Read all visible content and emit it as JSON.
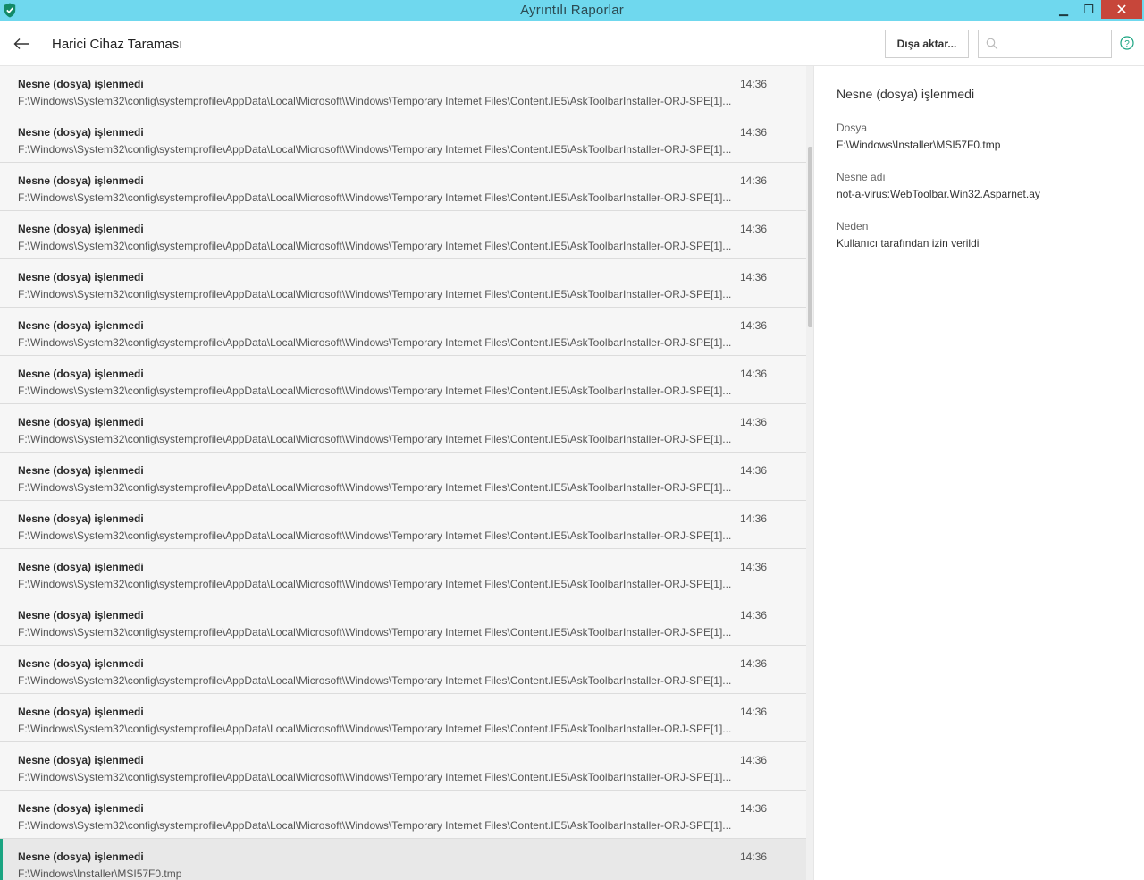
{
  "window": {
    "title": "Ayrıntılı Raporlar",
    "minimize_glyph": "▁",
    "restore_glyph": "❐",
    "close_glyph": "✕"
  },
  "header": {
    "title": "Harici Cihaz Taraması",
    "export_label": "Dışa aktar...",
    "search_placeholder": "",
    "search_value": ""
  },
  "list": {
    "items": [
      {
        "title": "Nesne (dosya) işlenmedi",
        "time": "14:36",
        "path": "F:\\Windows\\System32\\config\\systemprofile\\AppData\\Local\\Microsoft\\Windows\\Temporary Internet Files\\Content.IE5\\AskToolbarInstaller-ORJ-SPE[1]..."
      },
      {
        "title": "Nesne (dosya) işlenmedi",
        "time": "14:36",
        "path": "F:\\Windows\\System32\\config\\systemprofile\\AppData\\Local\\Microsoft\\Windows\\Temporary Internet Files\\Content.IE5\\AskToolbarInstaller-ORJ-SPE[1]..."
      },
      {
        "title": "Nesne (dosya) işlenmedi",
        "time": "14:36",
        "path": "F:\\Windows\\System32\\config\\systemprofile\\AppData\\Local\\Microsoft\\Windows\\Temporary Internet Files\\Content.IE5\\AskToolbarInstaller-ORJ-SPE[1]..."
      },
      {
        "title": "Nesne (dosya) işlenmedi",
        "time": "14:36",
        "path": "F:\\Windows\\System32\\config\\systemprofile\\AppData\\Local\\Microsoft\\Windows\\Temporary Internet Files\\Content.IE5\\AskToolbarInstaller-ORJ-SPE[1]..."
      },
      {
        "title": "Nesne (dosya) işlenmedi",
        "time": "14:36",
        "path": "F:\\Windows\\System32\\config\\systemprofile\\AppData\\Local\\Microsoft\\Windows\\Temporary Internet Files\\Content.IE5\\AskToolbarInstaller-ORJ-SPE[1]..."
      },
      {
        "title": "Nesne (dosya) işlenmedi",
        "time": "14:36",
        "path": "F:\\Windows\\System32\\config\\systemprofile\\AppData\\Local\\Microsoft\\Windows\\Temporary Internet Files\\Content.IE5\\AskToolbarInstaller-ORJ-SPE[1]..."
      },
      {
        "title": "Nesne (dosya) işlenmedi",
        "time": "14:36",
        "path": "F:\\Windows\\System32\\config\\systemprofile\\AppData\\Local\\Microsoft\\Windows\\Temporary Internet Files\\Content.IE5\\AskToolbarInstaller-ORJ-SPE[1]..."
      },
      {
        "title": "Nesne (dosya) işlenmedi",
        "time": "14:36",
        "path": "F:\\Windows\\System32\\config\\systemprofile\\AppData\\Local\\Microsoft\\Windows\\Temporary Internet Files\\Content.IE5\\AskToolbarInstaller-ORJ-SPE[1]..."
      },
      {
        "title": "Nesne (dosya) işlenmedi",
        "time": "14:36",
        "path": "F:\\Windows\\System32\\config\\systemprofile\\AppData\\Local\\Microsoft\\Windows\\Temporary Internet Files\\Content.IE5\\AskToolbarInstaller-ORJ-SPE[1]..."
      },
      {
        "title": "Nesne (dosya) işlenmedi",
        "time": "14:36",
        "path": "F:\\Windows\\System32\\config\\systemprofile\\AppData\\Local\\Microsoft\\Windows\\Temporary Internet Files\\Content.IE5\\AskToolbarInstaller-ORJ-SPE[1]..."
      },
      {
        "title": "Nesne (dosya) işlenmedi",
        "time": "14:36",
        "path": "F:\\Windows\\System32\\config\\systemprofile\\AppData\\Local\\Microsoft\\Windows\\Temporary Internet Files\\Content.IE5\\AskToolbarInstaller-ORJ-SPE[1]..."
      },
      {
        "title": "Nesne (dosya) işlenmedi",
        "time": "14:36",
        "path": "F:\\Windows\\System32\\config\\systemprofile\\AppData\\Local\\Microsoft\\Windows\\Temporary Internet Files\\Content.IE5\\AskToolbarInstaller-ORJ-SPE[1]..."
      },
      {
        "title": "Nesne (dosya) işlenmedi",
        "time": "14:36",
        "path": "F:\\Windows\\System32\\config\\systemprofile\\AppData\\Local\\Microsoft\\Windows\\Temporary Internet Files\\Content.IE5\\AskToolbarInstaller-ORJ-SPE[1]..."
      },
      {
        "title": "Nesne (dosya) işlenmedi",
        "time": "14:36",
        "path": "F:\\Windows\\System32\\config\\systemprofile\\AppData\\Local\\Microsoft\\Windows\\Temporary Internet Files\\Content.IE5\\AskToolbarInstaller-ORJ-SPE[1]..."
      },
      {
        "title": "Nesne (dosya) işlenmedi",
        "time": "14:36",
        "path": "F:\\Windows\\System32\\config\\systemprofile\\AppData\\Local\\Microsoft\\Windows\\Temporary Internet Files\\Content.IE5\\AskToolbarInstaller-ORJ-SPE[1]..."
      },
      {
        "title": "Nesne (dosya) işlenmedi",
        "time": "14:36",
        "path": "F:\\Windows\\System32\\config\\systemprofile\\AppData\\Local\\Microsoft\\Windows\\Temporary Internet Files\\Content.IE5\\AskToolbarInstaller-ORJ-SPE[1]..."
      },
      {
        "title": "Nesne (dosya) işlenmedi",
        "time": "14:36",
        "path": "F:\\Windows\\Installer\\MSI57F0.tmp",
        "selected": true
      }
    ]
  },
  "details": {
    "heading": "Nesne (dosya) işlenmedi",
    "fields": [
      {
        "label": "Dosya",
        "value": "F:\\Windows\\Installer\\MSI57F0.tmp"
      },
      {
        "label": "Nesne adı",
        "value": "not-a-virus:WebToolbar.Win32.Asparnet.ay"
      },
      {
        "label": "Neden",
        "value": "Kullanıcı tarafından izin verildi"
      }
    ]
  },
  "colors": {
    "titlebar": "#6fd8ee",
    "close_button": "#c7463a",
    "selection_accent": "#1aa481"
  },
  "icons": {
    "app": "shield-check-icon",
    "back": "arrow-left-icon",
    "search": "search-icon",
    "help": "help-circle-icon"
  }
}
